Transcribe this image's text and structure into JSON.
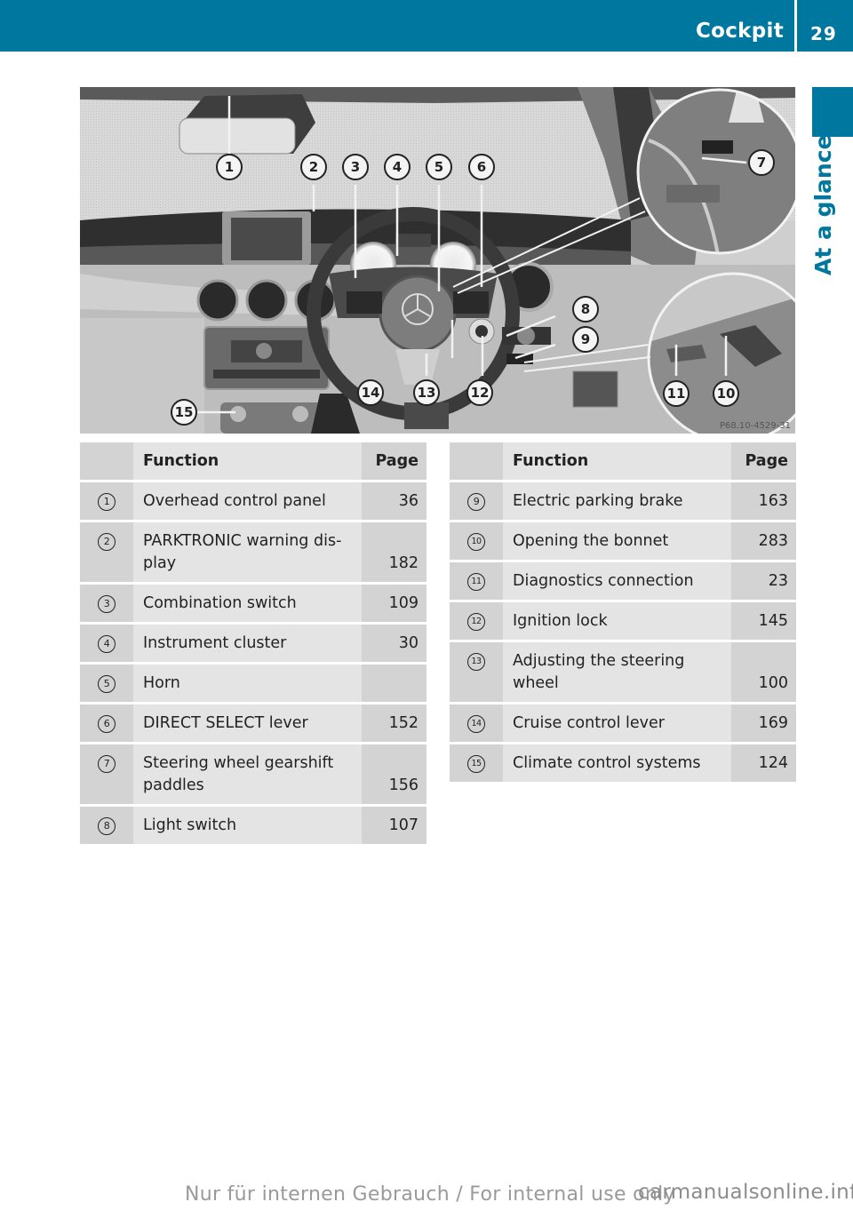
{
  "header": {
    "section_title": "Cockpit",
    "page_number": "29"
  },
  "side_tab": {
    "label": "At a glance"
  },
  "figure": {
    "description": "Cockpit overview photo (right-hand drive)",
    "image_code": "P68.10-4529-31",
    "callouts": [
      "1",
      "2",
      "3",
      "4",
      "5",
      "6",
      "7",
      "8",
      "9",
      "10",
      "11",
      "12",
      "13",
      "14",
      "15"
    ]
  },
  "tables": [
    {
      "headers": {
        "number": "",
        "function": "Function",
        "page": "Page"
      },
      "rows": [
        {
          "number": "1",
          "function": "Overhead control panel",
          "page": "36"
        },
        {
          "number": "2",
          "function": "PARKTRONIC warning dis-\nplay",
          "page": "182"
        },
        {
          "number": "3",
          "function": "Combination switch",
          "page": "109"
        },
        {
          "number": "4",
          "function": "Instrument cluster",
          "page": "30"
        },
        {
          "number": "5",
          "function": "Horn",
          "page": ""
        },
        {
          "number": "6",
          "function": "DIRECT SELECT lever",
          "page": "152"
        },
        {
          "number": "7",
          "function": "Steering wheel gearshift\npaddles",
          "page": "156"
        },
        {
          "number": "8",
          "function": "Light switch",
          "page": "107"
        }
      ]
    },
    {
      "headers": {
        "number": "",
        "function": "Function",
        "page": "Page"
      },
      "rows": [
        {
          "number": "9",
          "function": "Electric parking brake",
          "page": "163"
        },
        {
          "number": "10",
          "function": "Opening the bonnet",
          "page": "283"
        },
        {
          "number": "11",
          "function": "Diagnostics connection",
          "page": "23"
        },
        {
          "number": "12",
          "function": "Ignition lock",
          "page": "145"
        },
        {
          "number": "13",
          "function": "Adjusting the steering\nwheel",
          "page": "100"
        },
        {
          "number": "14",
          "function": "Cruise control lever",
          "page": "169"
        },
        {
          "number": "15",
          "function": "Climate control systems",
          "page": "124"
        }
      ]
    }
  ],
  "footer": {
    "watermark": "Nur für internen Gebrauch / For internal use only",
    "site": "carmanualsonline.info"
  },
  "colors": {
    "accent": "#00779e",
    "table_dark": "#d3d3d3",
    "table_light": "#e4e4e4"
  }
}
